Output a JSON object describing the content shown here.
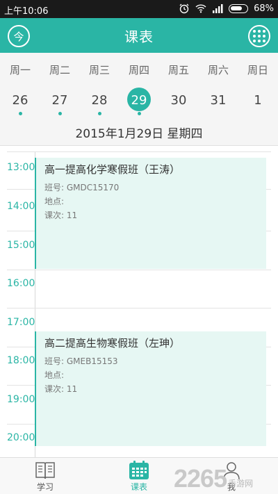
{
  "status_bar": {
    "time": "上午10:06",
    "battery": "68%"
  },
  "header": {
    "title": "课表",
    "left_button": "今"
  },
  "week": {
    "days": [
      "周一",
      "周二",
      "周三",
      "周四",
      "周五",
      "周六",
      "周日"
    ],
    "dates": [
      {
        "num": "26",
        "has_event": true,
        "active": false
      },
      {
        "num": "27",
        "has_event": true,
        "active": false
      },
      {
        "num": "28",
        "has_event": true,
        "active": false
      },
      {
        "num": "29",
        "has_event": true,
        "active": true
      },
      {
        "num": "30",
        "has_event": false,
        "active": false
      },
      {
        "num": "31",
        "has_event": false,
        "active": false
      },
      {
        "num": "1",
        "has_event": false,
        "active": false
      }
    ],
    "full_date": "2015年1月29日 星期四"
  },
  "schedule": {
    "hours": [
      "13:00",
      "14:00",
      "15:00",
      "16:00",
      "17:00",
      "18:00",
      "19:00",
      "20:00"
    ],
    "events": [
      {
        "title": "高一提高化学寒假班（王涛）",
        "class_no": "班号: GMDC15170",
        "location": "地点:",
        "session": "课次: 11"
      },
      {
        "title": "高二提高生物寒假班（左珅）",
        "class_no": "班号: GMEB15153",
        "location": "地点:",
        "session": "课次: 11"
      }
    ]
  },
  "bottom_nav": {
    "study": "学习",
    "schedule": "课表",
    "me": "我"
  },
  "colors": {
    "accent": "#2ab5a5",
    "event_bg": "#e6f7f3"
  },
  "watermark": {
    "number": "2265",
    "text": "手游网"
  }
}
